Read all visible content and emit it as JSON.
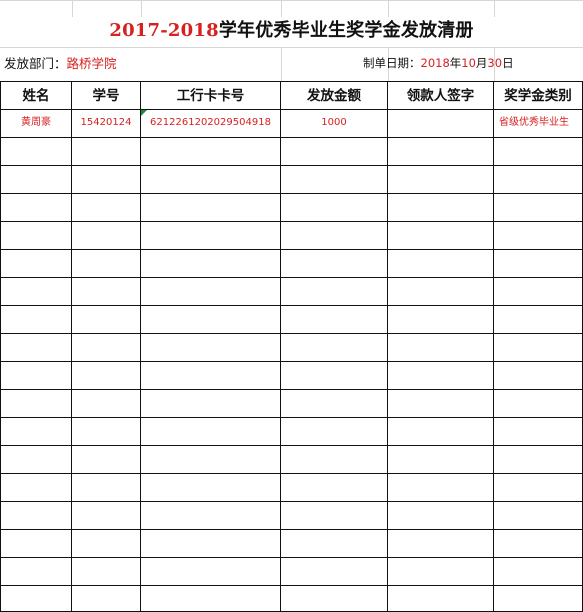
{
  "title": {
    "year": "2017-2018",
    "rest": "学年优秀毕业生奖学金发放清册"
  },
  "info": {
    "dept_label": "发放部门：",
    "dept_value": "路桥学院",
    "date_label": "制单日期：",
    "date_year": "2018",
    "date_year_unit": "年",
    "date_month": "10",
    "date_month_unit": "月",
    "date_day": "30",
    "date_day_unit": "日"
  },
  "table": {
    "headers": [
      "姓名",
      "学号",
      "工行卡卡号",
      "发放金额",
      "领款人签字",
      "奖学金类别"
    ],
    "rows": [
      [
        "黄周豪",
        "15420124",
        "6212261202029504918",
        "1000",
        "",
        "省级优秀毕业生"
      ]
    ]
  }
}
